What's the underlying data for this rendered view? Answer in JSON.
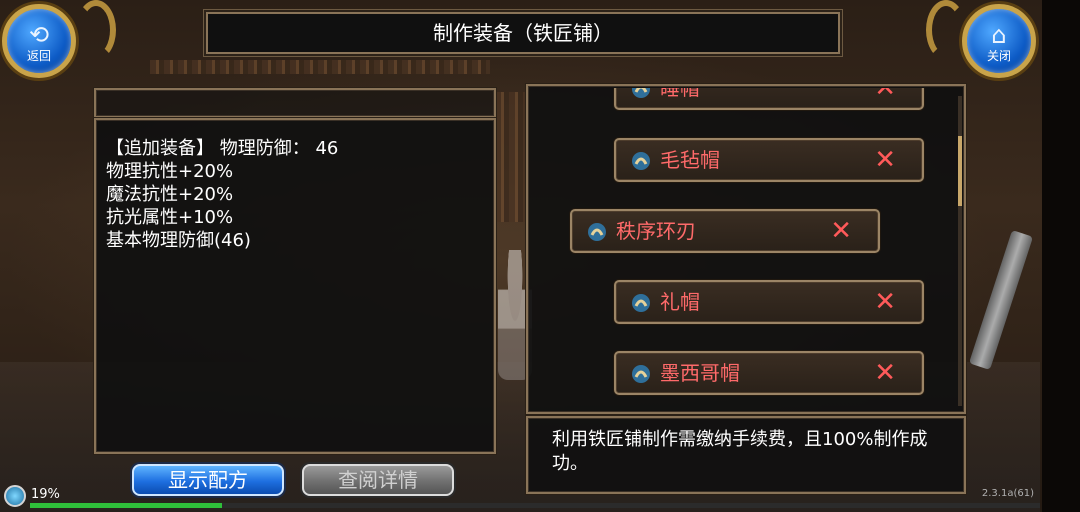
{
  "title": "制作装备（铁匠铺）",
  "back_button": {
    "label": "返回",
    "icon": "back-arrow-icon"
  },
  "close_button": {
    "label": "关闭",
    "icon": "home-icon"
  },
  "detail": {
    "lines": [
      "【追加装备】 物理防御：  46",
      "物理抗性+20%",
      "魔法抗性+20%",
      "抗光属性+10%",
      "基本物理防御(46)"
    ]
  },
  "buttons": {
    "show_recipe": "显示配方",
    "view_details": "查阅详情"
  },
  "items": [
    {
      "name": "睡帽",
      "icon": "scroll-icon",
      "remove_icon": "close-icon"
    },
    {
      "name": "毛毡帽",
      "icon": "scroll-icon",
      "remove_icon": "close-icon"
    },
    {
      "name": "秩序环刃",
      "icon": "scroll-icon",
      "remove_icon": "close-icon",
      "selected": true
    },
    {
      "name": "礼帽",
      "icon": "scroll-icon",
      "remove_icon": "close-icon"
    },
    {
      "name": "墨西哥帽",
      "icon": "scroll-icon",
      "remove_icon": "close-icon"
    }
  ],
  "info_text": "利用铁匠铺制作需缴纳手续费，且100%制作成功。",
  "status": {
    "percent": "19%",
    "exp_fraction": 0.19,
    "version": "2.3.1a(61)"
  },
  "colors": {
    "item_text": "#ff6a6a",
    "primary_button": "#1e6fe0",
    "exp_bar": "#2fbf3a",
    "frame_border": "#8a7458"
  }
}
